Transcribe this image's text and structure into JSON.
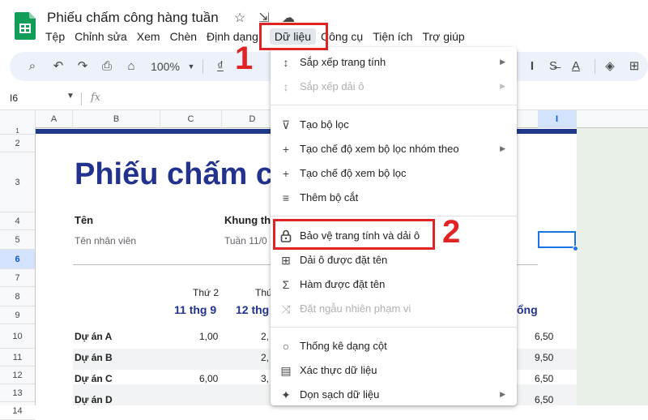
{
  "header": {
    "doc_title": "Phiếu chấm công hàng tuần",
    "menu": [
      "Tệp",
      "Chỉnh sửa",
      "Xem",
      "Chèn",
      "Định dạng",
      "Dữ liệu",
      "Công cụ",
      "Tiện ích",
      "Trợ giúp"
    ],
    "active_menu": "Dữ liệu"
  },
  "toolbar": {
    "zoom": "100%",
    "currency_symbol": "₫"
  },
  "formula_bar": {
    "cell_ref": "I6",
    "fx": "fx"
  },
  "grid": {
    "columns": [
      "A",
      "B",
      "C",
      "D",
      "I"
    ],
    "selected_column": "I",
    "rows": [
      "1",
      "2",
      "3",
      "4",
      "5",
      "6",
      "7",
      "8",
      "9",
      "10",
      "11",
      "12",
      "13",
      "14"
    ],
    "selected_row": "6"
  },
  "sheet": {
    "title": "Phiếu chấm c",
    "name_label": "Tên",
    "name_value": "Tên nhân viên",
    "period_label": "Khung th",
    "period_value": "Tuần 11/0",
    "days": [
      "Thứ 2",
      "Thứ"
    ],
    "dates": [
      "11 thg 9",
      "12 thg"
    ],
    "total_partial": "ổng",
    "projects": [
      {
        "name": "Dự án A",
        "mon": "1,00",
        "tue": "2,",
        "total": "6,50"
      },
      {
        "name": "Dự án B",
        "mon": "",
        "tue": "2,",
        "total": "9,50"
      },
      {
        "name": "Dự án C",
        "mon": "6,00",
        "tue": "3,",
        "total": "6,50"
      },
      {
        "name": "Dự án D",
        "mon": "",
        "tue": "",
        "total": "6,50"
      }
    ]
  },
  "dropdown": {
    "items": [
      {
        "icon": "sort-icon",
        "glyph": "↕",
        "label": "Sắp xếp trang tính",
        "submenu": true,
        "disabled": false
      },
      {
        "icon": "sort-range-icon",
        "glyph": "↕",
        "label": "Sắp xếp dải ô",
        "submenu": true,
        "disabled": true
      },
      {
        "icon": "filter-icon",
        "glyph": "⊽",
        "label": "Tạo bộ lọc",
        "submenu": false,
        "disabled": false
      },
      {
        "icon": "plus-icon",
        "glyph": "+",
        "label": "Tạo chế độ xem bộ lọc nhóm theo",
        "submenu": true,
        "disabled": false
      },
      {
        "icon": "plus-icon",
        "glyph": "+",
        "label": "Tạo chế độ xem bộ lọc",
        "submenu": false,
        "disabled": false
      },
      {
        "icon": "slicer-icon",
        "glyph": "≡",
        "label": "Thêm bộ cắt",
        "submenu": false,
        "disabled": false
      },
      {
        "icon": "lock-icon",
        "glyph": "🔒",
        "label": "Bảo vệ trang tính và dải ô",
        "submenu": false,
        "disabled": false
      },
      {
        "icon": "named-range-icon",
        "glyph": "⊞",
        "label": "Dải ô được đặt tên",
        "submenu": false,
        "disabled": false
      },
      {
        "icon": "sigma-icon",
        "glyph": "Σ",
        "label": "Hàm được đặt tên",
        "submenu": false,
        "disabled": false
      },
      {
        "icon": "shuffle-icon",
        "glyph": "⤨",
        "label": "Đặt ngẫu nhiên phạm vi",
        "submenu": false,
        "disabled": true
      },
      {
        "icon": "bulb-icon",
        "glyph": "○",
        "label": "Thống kê dạng cột",
        "submenu": false,
        "disabled": false
      },
      {
        "icon": "validation-icon",
        "glyph": "▤",
        "label": "Xác thực dữ liệu",
        "submenu": false,
        "disabled": false
      },
      {
        "icon": "magic-wand-icon",
        "glyph": "✦",
        "label": "Dọn sạch dữ liệu",
        "submenu": true,
        "disabled": false
      }
    ]
  },
  "annotations": {
    "step1": "1",
    "step2": "2",
    "color": "#e02424"
  },
  "colors": {
    "accent": "#22328f",
    "band": "#1f3a8a",
    "selection": "#1a73e8",
    "sheets_green": "#0f9d58"
  }
}
